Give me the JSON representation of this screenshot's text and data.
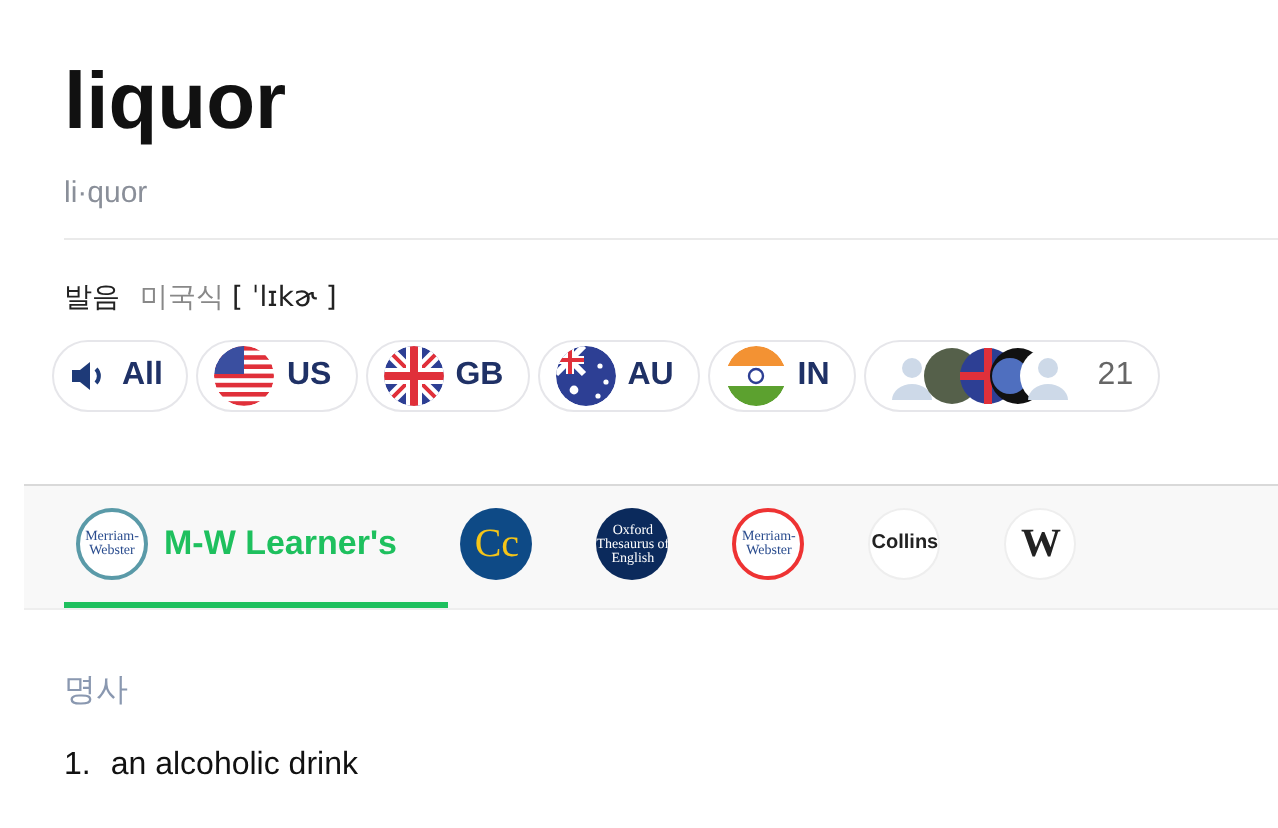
{
  "word": {
    "title": "liquor",
    "syllables": "li·quor"
  },
  "pronunciation": {
    "label": "발음",
    "variant": "미국식",
    "ipa": "[ ˈlɪkɚ ]"
  },
  "audio_buttons": [
    {
      "kind": "speaker",
      "label": "All"
    },
    {
      "kind": "us",
      "label": "US"
    },
    {
      "kind": "gb",
      "label": "GB"
    },
    {
      "kind": "au",
      "label": "AU"
    },
    {
      "kind": "in",
      "label": "IN"
    },
    {
      "kind": "users",
      "label": "21"
    }
  ],
  "dictionary_tabs": [
    {
      "kind": "mw-learner",
      "logo_text": [
        "Merriam-",
        "Webster"
      ],
      "label": "M-W Learner's",
      "selected": true
    },
    {
      "kind": "cc",
      "logo_text": [
        "Cc"
      ],
      "selected": false
    },
    {
      "kind": "oxford",
      "logo_text": [
        "Oxford",
        "Thesaurus of",
        "English"
      ],
      "selected": false
    },
    {
      "kind": "mw",
      "logo_text": [
        "Merriam-",
        "Webster"
      ],
      "selected": false
    },
    {
      "kind": "collins",
      "logo_text": [
        "Collins"
      ],
      "selected": false
    },
    {
      "kind": "wiki",
      "logo_text": [
        "W"
      ],
      "selected": false
    }
  ],
  "part_of_speech": "명사",
  "definitions": [
    {
      "number": "1.",
      "text": "an alcoholic drink"
    }
  ]
}
